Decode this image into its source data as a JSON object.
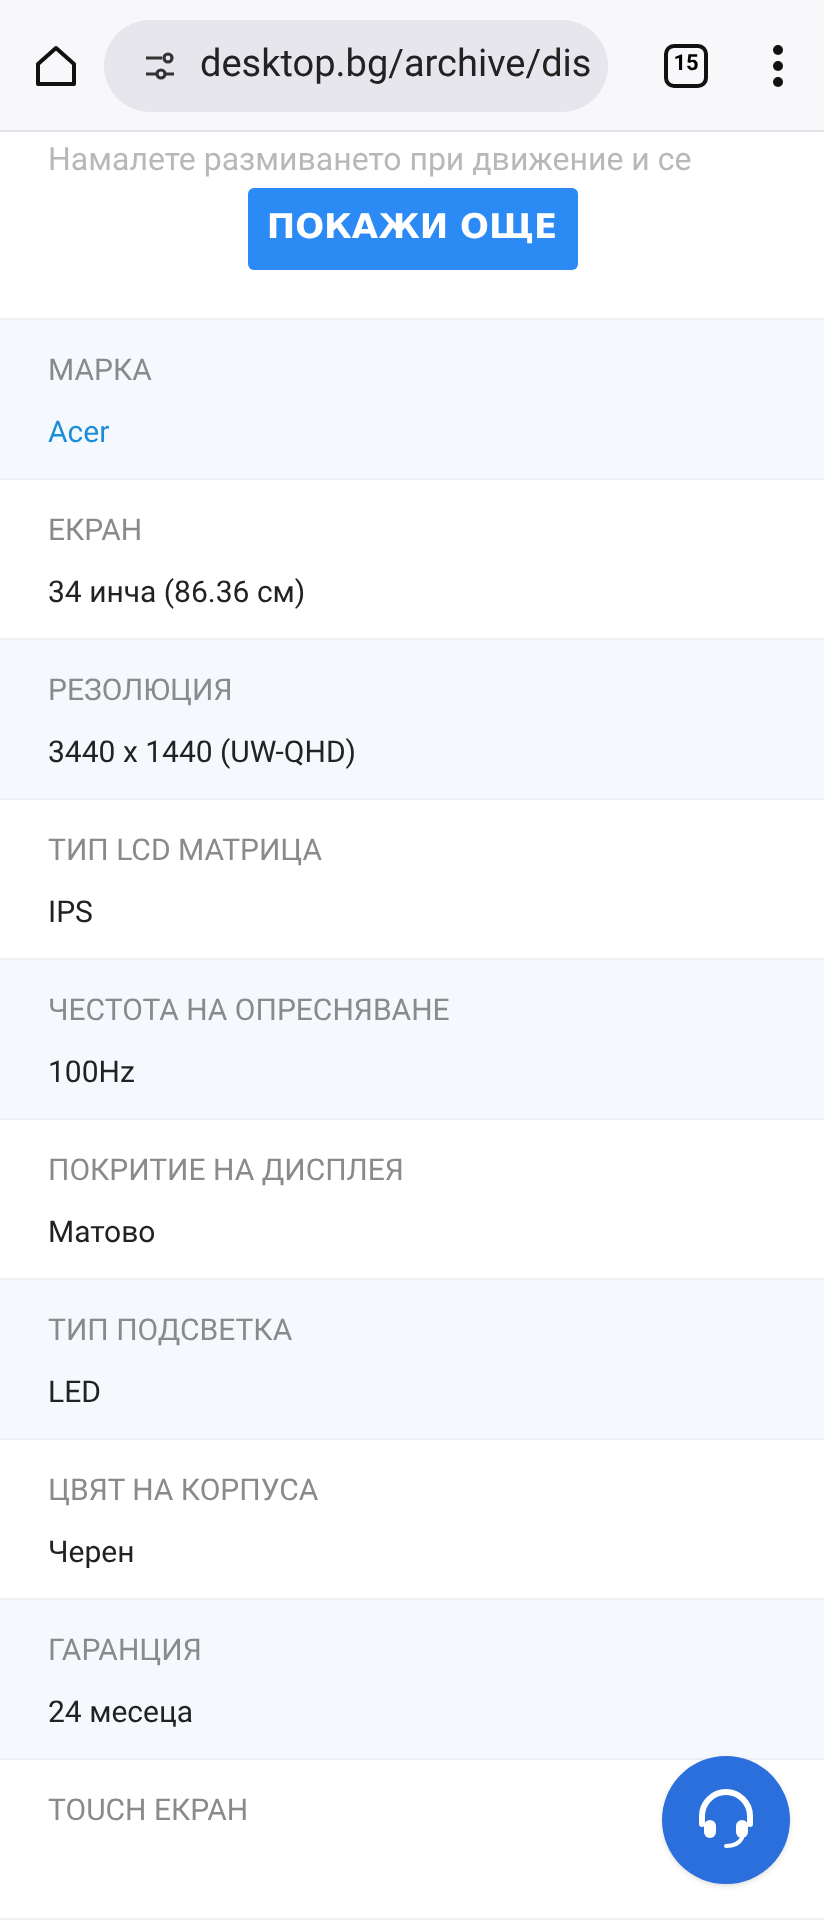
{
  "browser": {
    "url": "desktop.bg/archive/dis",
    "tab_count": "15"
  },
  "description_fade": "Намалете размиването при движение и се",
  "show_more_button": "ПОКАЖИ ОЩЕ",
  "specs": [
    {
      "label": "МАРКА",
      "value": "Acer",
      "kind": "link"
    },
    {
      "label": "ЕКРАН",
      "value": "34 инча (86.36 см)",
      "kind": "text"
    },
    {
      "label": "РЕЗОЛЮЦИЯ",
      "value": "3440 x 1440 (UW-QHD)",
      "kind": "text"
    },
    {
      "label": "ТИП LCD МАТРИЦА",
      "value": "IPS",
      "kind": "text"
    },
    {
      "label": "ЧЕСТОТА НА ОПРЕСНЯВАНЕ",
      "value": "100Hz",
      "kind": "text"
    },
    {
      "label": "ПОКРИТИЕ НА ДИСПЛЕЯ",
      "value": "Матово",
      "kind": "text"
    },
    {
      "label": "ТИП ПОДСВЕТКА",
      "value": "LED",
      "kind": "text"
    },
    {
      "label": "ЦВЯТ НА КОРПУСА",
      "value": "Черен",
      "kind": "text"
    },
    {
      "label": "ГАРАНЦИЯ",
      "value": "24 месеца",
      "kind": "text"
    },
    {
      "label": "TOUCH ЕКРАН"
    }
  ]
}
